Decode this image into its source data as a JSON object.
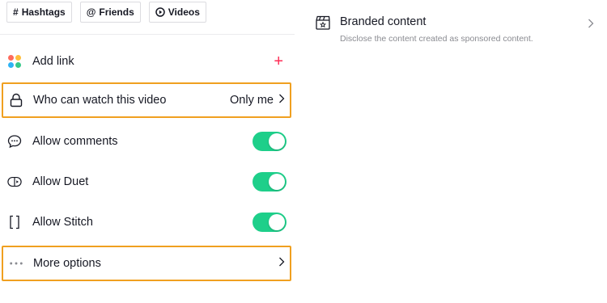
{
  "tags": {
    "hashtags": {
      "symbol": "#",
      "label": "Hashtags",
      "icon": "hash-icon"
    },
    "friends": {
      "symbol": "@",
      "label": "Friends",
      "icon": "at-icon"
    },
    "videos": {
      "label": "Videos",
      "icon": "play-circle-icon"
    }
  },
  "settings": {
    "add_link": {
      "label": "Add link",
      "icon": "apps-icon",
      "action_symbol": "+"
    },
    "who_can_watch": {
      "label": "Who can watch this video",
      "value": "Only me",
      "icon": "lock-icon"
    },
    "allow_comments": {
      "label": "Allow comments",
      "on": true,
      "icon": "comment-icon"
    },
    "allow_duet": {
      "label": "Allow Duet",
      "on": true,
      "icon": "duet-icon"
    },
    "allow_stitch": {
      "label": "Allow Stitch",
      "on": true,
      "icon": "stitch-icon"
    },
    "more_options": {
      "label": "More options",
      "icon": "more-dots-icon"
    }
  },
  "branded": {
    "title": "Branded content",
    "subtitle": "Disclose the content created as sponsored content.",
    "icon": "clapperboard-icon"
  },
  "colors": {
    "toggle_on": "#1ecf8a",
    "highlight_border": "#f0a020",
    "plus_accent": "#fe2c55",
    "text_primary": "#161823",
    "text_secondary": "#8a8b91"
  }
}
